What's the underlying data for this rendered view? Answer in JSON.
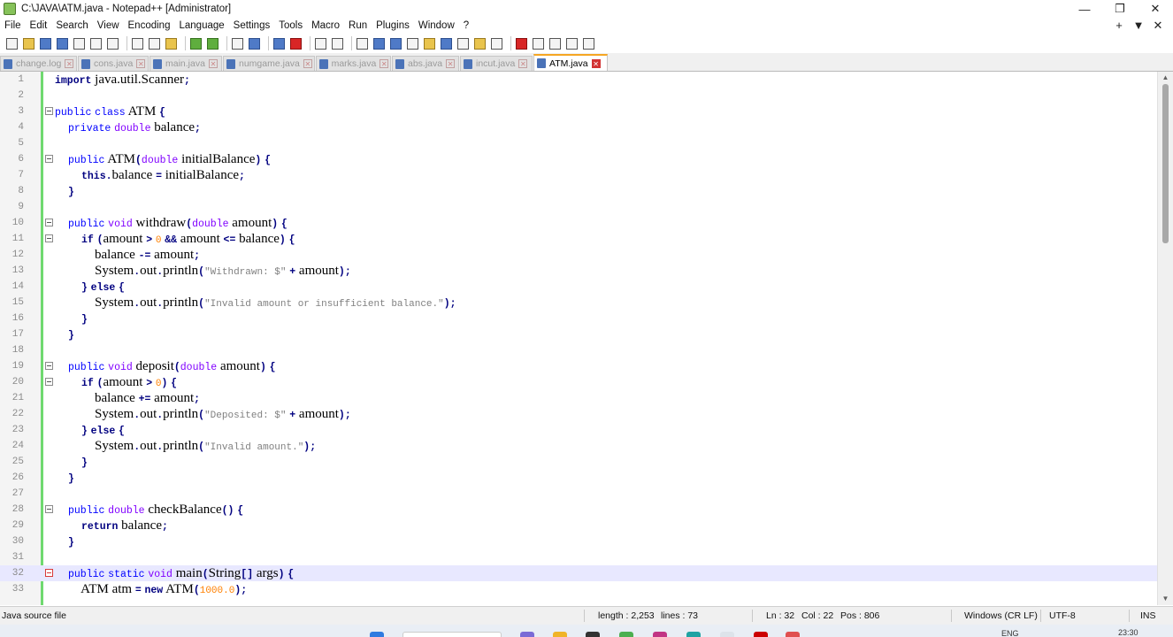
{
  "window": {
    "title": "C:\\JAVA\\ATM.java - Notepad++ [Administrator]",
    "controls": [
      "—",
      "❐",
      "✕"
    ]
  },
  "menu": [
    "File",
    "Edit",
    "Search",
    "View",
    "Encoding",
    "Language",
    "Settings",
    "Tools",
    "Macro",
    "Run",
    "Plugins",
    "Window",
    "?"
  ],
  "menu_right": [
    "+",
    "▼",
    "✕"
  ],
  "tabs": [
    {
      "label": "change.log",
      "width": 87
    },
    {
      "label": "cons.java",
      "width": 80
    },
    {
      "label": "main.java",
      "width": 82
    },
    {
      "label": "numgame.java",
      "width": 104
    },
    {
      "label": "marks.java",
      "width": 85
    },
    {
      "label": "abs.java",
      "width": 76
    },
    {
      "label": "incut.java",
      "width": 82
    },
    {
      "label": "ATM.java",
      "width": 84,
      "active": true
    }
  ],
  "editor": {
    "current_line": 32,
    "lines": [
      {
        "n": "1",
        "code": [
          [
            "kwb",
            "import"
          ],
          [
            "t",
            " java.util.Scanner"
          ],
          [
            "op",
            ";"
          ]
        ]
      },
      {
        "n": "2",
        "code": []
      },
      {
        "n": "3",
        "fold": true,
        "code": [
          [
            "kw",
            "public"
          ],
          [
            "t",
            " "
          ],
          [
            "kw",
            "class"
          ],
          [
            "t",
            " ATM "
          ],
          [
            "op",
            "{"
          ]
        ]
      },
      {
        "n": "4",
        "code": [
          [
            "t",
            "    "
          ],
          [
            "kw",
            "private"
          ],
          [
            "t",
            " "
          ],
          [
            "ty",
            "double"
          ],
          [
            "t",
            " balance"
          ],
          [
            "op",
            ";"
          ]
        ]
      },
      {
        "n": "5",
        "code": []
      },
      {
        "n": "6",
        "fold": true,
        "code": [
          [
            "t",
            "    "
          ],
          [
            "kw",
            "public"
          ],
          [
            "t",
            " ATM"
          ],
          [
            "op",
            "("
          ],
          [
            "ty",
            "double"
          ],
          [
            "t",
            " initialBalance"
          ],
          [
            "op",
            ")"
          ],
          [
            "t",
            " "
          ],
          [
            "op",
            "{"
          ]
        ]
      },
      {
        "n": "7",
        "code": [
          [
            "t",
            "        "
          ],
          [
            "kwb",
            "this"
          ],
          [
            "op",
            "."
          ],
          [
            "t",
            "balance "
          ],
          [
            "op",
            "="
          ],
          [
            "t",
            " initialBalance"
          ],
          [
            "op",
            ";"
          ]
        ]
      },
      {
        "n": "8",
        "code": [
          [
            "t",
            "    "
          ],
          [
            "op",
            "}"
          ]
        ]
      },
      {
        "n": "9",
        "code": []
      },
      {
        "n": "10",
        "fold": true,
        "code": [
          [
            "t",
            "    "
          ],
          [
            "kw",
            "public"
          ],
          [
            "t",
            " "
          ],
          [
            "ty",
            "void"
          ],
          [
            "t",
            " withdraw"
          ],
          [
            "op",
            "("
          ],
          [
            "ty",
            "double"
          ],
          [
            "t",
            " amount"
          ],
          [
            "op",
            ")"
          ],
          [
            "t",
            " "
          ],
          [
            "op",
            "{"
          ]
        ]
      },
      {
        "n": "11",
        "fold": true,
        "code": [
          [
            "t",
            "        "
          ],
          [
            "kwb",
            "if"
          ],
          [
            "t",
            " "
          ],
          [
            "op",
            "("
          ],
          [
            "t",
            "amount "
          ],
          [
            "op",
            ">"
          ],
          [
            "t",
            " "
          ],
          [
            "num",
            "0"
          ],
          [
            "t",
            " "
          ],
          [
            "op",
            "&&"
          ],
          [
            "t",
            " amount "
          ],
          [
            "op",
            "<="
          ],
          [
            "t",
            " balance"
          ],
          [
            "op",
            ")"
          ],
          [
            "t",
            " "
          ],
          [
            "op",
            "{"
          ]
        ]
      },
      {
        "n": "12",
        "code": [
          [
            "t",
            "            balance "
          ],
          [
            "op",
            "-="
          ],
          [
            "t",
            " amount"
          ],
          [
            "op",
            ";"
          ]
        ]
      },
      {
        "n": "13",
        "code": [
          [
            "t",
            "            System"
          ],
          [
            "op",
            "."
          ],
          [
            "t",
            "out"
          ],
          [
            "op",
            "."
          ],
          [
            "t",
            "println"
          ],
          [
            "op",
            "("
          ],
          [
            "str",
            "\"Withdrawn: $\""
          ],
          [
            "t",
            " "
          ],
          [
            "op",
            "+"
          ],
          [
            "t",
            " amount"
          ],
          [
            "op",
            ")"
          ],
          [
            "op",
            ";"
          ]
        ]
      },
      {
        "n": "14",
        "code": [
          [
            "t",
            "        "
          ],
          [
            "op",
            "}"
          ],
          [
            "t",
            " "
          ],
          [
            "kwb",
            "else"
          ],
          [
            "t",
            " "
          ],
          [
            "op",
            "{"
          ]
        ]
      },
      {
        "n": "15",
        "code": [
          [
            "t",
            "            System"
          ],
          [
            "op",
            "."
          ],
          [
            "t",
            "out"
          ],
          [
            "op",
            "."
          ],
          [
            "t",
            "println"
          ],
          [
            "op",
            "("
          ],
          [
            "str",
            "\"Invalid amount or insufficient balance.\""
          ],
          [
            "op",
            ")"
          ],
          [
            "op",
            ";"
          ]
        ]
      },
      {
        "n": "16",
        "code": [
          [
            "t",
            "        "
          ],
          [
            "op",
            "}"
          ]
        ]
      },
      {
        "n": "17",
        "code": [
          [
            "t",
            "    "
          ],
          [
            "op",
            "}"
          ]
        ]
      },
      {
        "n": "18",
        "code": []
      },
      {
        "n": "19",
        "fold": true,
        "code": [
          [
            "t",
            "    "
          ],
          [
            "kw",
            "public"
          ],
          [
            "t",
            " "
          ],
          [
            "ty",
            "void"
          ],
          [
            "t",
            " deposit"
          ],
          [
            "op",
            "("
          ],
          [
            "ty",
            "double"
          ],
          [
            "t",
            " amount"
          ],
          [
            "op",
            ")"
          ],
          [
            "t",
            " "
          ],
          [
            "op",
            "{"
          ]
        ]
      },
      {
        "n": "20",
        "fold": true,
        "code": [
          [
            "t",
            "        "
          ],
          [
            "kwb",
            "if"
          ],
          [
            "t",
            " "
          ],
          [
            "op",
            "("
          ],
          [
            "t",
            "amount "
          ],
          [
            "op",
            ">"
          ],
          [
            "t",
            " "
          ],
          [
            "num",
            "0"
          ],
          [
            "op",
            ")"
          ],
          [
            "t",
            " "
          ],
          [
            "op",
            "{"
          ]
        ]
      },
      {
        "n": "21",
        "code": [
          [
            "t",
            "            balance "
          ],
          [
            "op",
            "+="
          ],
          [
            "t",
            " amount"
          ],
          [
            "op",
            ";"
          ]
        ]
      },
      {
        "n": "22",
        "code": [
          [
            "t",
            "            System"
          ],
          [
            "op",
            "."
          ],
          [
            "t",
            "out"
          ],
          [
            "op",
            "."
          ],
          [
            "t",
            "println"
          ],
          [
            "op",
            "("
          ],
          [
            "str",
            "\"Deposited: $\""
          ],
          [
            "t",
            " "
          ],
          [
            "op",
            "+"
          ],
          [
            "t",
            " amount"
          ],
          [
            "op",
            ")"
          ],
          [
            "op",
            ";"
          ]
        ]
      },
      {
        "n": "23",
        "code": [
          [
            "t",
            "        "
          ],
          [
            "op",
            "}"
          ],
          [
            "t",
            " "
          ],
          [
            "kwb",
            "else"
          ],
          [
            "t",
            " "
          ],
          [
            "op",
            "{"
          ]
        ]
      },
      {
        "n": "24",
        "code": [
          [
            "t",
            "            System"
          ],
          [
            "op",
            "."
          ],
          [
            "t",
            "out"
          ],
          [
            "op",
            "."
          ],
          [
            "t",
            "println"
          ],
          [
            "op",
            "("
          ],
          [
            "str",
            "\"Invalid amount.\""
          ],
          [
            "op",
            ")"
          ],
          [
            "op",
            ";"
          ]
        ]
      },
      {
        "n": "25",
        "code": [
          [
            "t",
            "        "
          ],
          [
            "op",
            "}"
          ]
        ]
      },
      {
        "n": "26",
        "code": [
          [
            "t",
            "    "
          ],
          [
            "op",
            "}"
          ]
        ]
      },
      {
        "n": "27",
        "code": []
      },
      {
        "n": "28",
        "fold": true,
        "code": [
          [
            "t",
            "    "
          ],
          [
            "kw",
            "public"
          ],
          [
            "t",
            " "
          ],
          [
            "ty",
            "double"
          ],
          [
            "t",
            " checkBalance"
          ],
          [
            "op",
            "("
          ],
          [
            "op",
            ")"
          ],
          [
            "t",
            " "
          ],
          [
            "op",
            "{"
          ]
        ]
      },
      {
        "n": "29",
        "code": [
          [
            "t",
            "        "
          ],
          [
            "kwb",
            "return"
          ],
          [
            "t",
            " balance"
          ],
          [
            "op",
            ";"
          ]
        ]
      },
      {
        "n": "30",
        "code": [
          [
            "t",
            "    "
          ],
          [
            "op",
            "}"
          ]
        ]
      },
      {
        "n": "31",
        "code": []
      },
      {
        "n": "32",
        "fold": true,
        "foldRed": true,
        "code": [
          [
            "t",
            "    "
          ],
          [
            "kw",
            "public"
          ],
          [
            "t",
            " "
          ],
          [
            "kw",
            "static"
          ],
          [
            "t",
            " "
          ],
          [
            "ty",
            "void"
          ],
          [
            "t",
            " main"
          ],
          [
            "op",
            "("
          ],
          [
            "t",
            "String"
          ],
          [
            "op",
            "[]"
          ],
          [
            "t",
            " args"
          ],
          [
            "op",
            ")"
          ],
          [
            "t",
            " "
          ],
          [
            "op",
            "{"
          ]
        ]
      },
      {
        "n": "33",
        "code": [
          [
            "t",
            "        ATM atm "
          ],
          [
            "op",
            "="
          ],
          [
            "t",
            " "
          ],
          [
            "kwb",
            "new"
          ],
          [
            "t",
            " ATM"
          ],
          [
            "op",
            "("
          ],
          [
            "num",
            "1000.0"
          ],
          [
            "op",
            ")"
          ],
          [
            "op",
            ";"
          ]
        ]
      }
    ]
  },
  "status": {
    "file_type": "Java source file",
    "length": "length : 2,253",
    "lines": "lines : 73",
    "ln": "Ln : 32",
    "col": "Col : 22",
    "pos": "Pos : 806",
    "eol": "Windows (CR LF)",
    "encoding": "UTF-8",
    "mode": "INS"
  },
  "taskbar": {
    "lang": "ENG",
    "time": "23:30"
  },
  "colors": {
    "keyword": "#0000ff",
    "keyword_bold": "#000080",
    "type": "#8000ff",
    "string": "#808080",
    "number": "#ff8000",
    "current_line": "#e8e8ff",
    "change_bar": "#6fd96f",
    "active_tab_accent": "#f5a623"
  }
}
